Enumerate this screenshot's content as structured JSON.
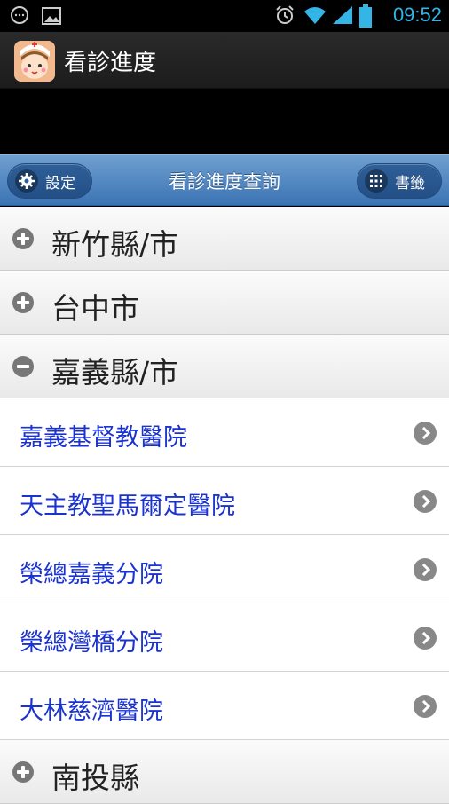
{
  "status_bar": {
    "time": "09:52",
    "icons": [
      "messaging-icon",
      "image-icon",
      "alarm-icon",
      "wifi-icon",
      "signal-icon",
      "battery-icon"
    ]
  },
  "app_bar": {
    "title": "看診進度"
  },
  "header": {
    "title": "看診進度查詢",
    "settings_label": "設定",
    "bookmarks_label": "書籤"
  },
  "groups": [
    {
      "label": "新竹縣/市",
      "expanded": false
    },
    {
      "label": "台中市",
      "expanded": false
    },
    {
      "label": "嘉義縣/市",
      "expanded": true,
      "items": [
        "嘉義基督教醫院",
        "天主教聖馬爾定醫院",
        "榮總嘉義分院",
        "榮總灣橋分院",
        "大林慈濟醫院"
      ]
    },
    {
      "label": "南投縣",
      "expanded": false
    }
  ],
  "colors": {
    "header_blue": "#3b74b4",
    "link_blue": "#1a33d0",
    "status_blue": "#33b5e5"
  }
}
